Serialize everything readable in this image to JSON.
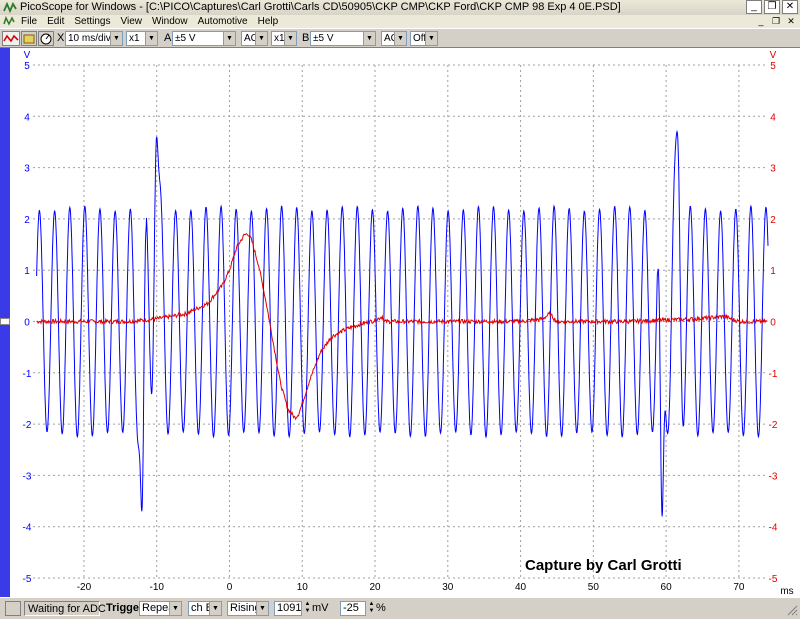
{
  "window": {
    "title": "PicoScope for Windows - [C:\\PICO\\Captures\\Carl Grotti\\Carls CD\\50905\\CKP CMP\\CKP Ford\\CKP CMP 98 Exp 4 0E.PSD]",
    "minimize": "_",
    "restore": "❐",
    "close": "✕"
  },
  "menu": {
    "items": [
      "File",
      "Edit",
      "Settings",
      "View",
      "Window",
      "Automotive",
      "Help"
    ],
    "mdi_minimize": "_",
    "mdi_restore": "❐",
    "mdi_close": "✕"
  },
  "toolbar": {
    "x_label": "X",
    "timebase": "10 ms/div",
    "multiplier": "x1",
    "mode_value": "A",
    "a_label": "A",
    "a_range": "±5 V",
    "a_coupling": "AC",
    "a_mult": "x1",
    "b_label": "B",
    "b_range": "±5 V",
    "b_coupling": "AC",
    "b_extra": "Off"
  },
  "statusbar": {
    "status": "Waiting for ADC",
    "trigger_label": "Trigger",
    "trigger_mode": "Repeat",
    "trigger_channel": "ch B",
    "trigger_edge": "Rising",
    "trigger_level": "1091",
    "level_unit": "mV",
    "pretrigger": "-25",
    "pretrigger_unit": "%"
  },
  "colors": {
    "channel_a": "#0000ff",
    "channel_b": "#e00000",
    "grid": "#a0a0a0"
  },
  "chart_data": {
    "type": "line",
    "watermark": "Capture by Carl Grotti",
    "left_axis_unit": "V",
    "right_axis_unit": "V",
    "x_unit": "ms",
    "xlim": [
      -27,
      74
    ],
    "ylim": [
      -5,
      5
    ],
    "x_ticks": [
      -20,
      -10,
      0,
      10,
      20,
      30,
      40,
      50,
      60,
      70
    ],
    "y_ticks": [
      5,
      4,
      3,
      2,
      1,
      0,
      -1,
      -2,
      -3,
      -4,
      -5
    ],
    "grid": true,
    "series": [
      {
        "channel": "A",
        "color": "#0000ff",
        "pattern": "square-ish crankshaft position sensor oscillation",
        "cycle_period_ms": 2.08,
        "amplitude_v": 2.2,
        "x_start": -26.5,
        "x_end": 74,
        "missing_tooth_events": [
          {
            "x": -11.5,
            "peak_v": 3.6,
            "trough_v": -3.7
          },
          {
            "x": 60.0,
            "peak_v": 3.7,
            "trough_v": -3.8
          }
        ]
      },
      {
        "channel": "B",
        "color": "#e00000",
        "pattern": "camshaft position sensor pulse",
        "points": [
          [
            -26.5,
            0.0
          ],
          [
            -20,
            0.0
          ],
          [
            -14,
            0.0
          ],
          [
            -10,
            0.05
          ],
          [
            -6,
            0.15
          ],
          [
            -3,
            0.35
          ],
          [
            -1,
            0.7
          ],
          [
            0,
            1.0
          ],
          [
            1,
            1.45
          ],
          [
            2,
            1.68
          ],
          [
            2.5,
            1.72
          ],
          [
            3,
            1.6
          ],
          [
            4,
            1.1
          ],
          [
            5,
            0.4
          ],
          [
            6,
            -0.4
          ],
          [
            7,
            -1.2
          ],
          [
            8,
            -1.7
          ],
          [
            9,
            -1.88
          ],
          [
            9.5,
            -1.8
          ],
          [
            10,
            -1.6
          ],
          [
            11,
            -1.15
          ],
          [
            12.5,
            -0.6
          ],
          [
            14,
            -0.3
          ],
          [
            16,
            -0.15
          ],
          [
            18,
            -0.05
          ],
          [
            20,
            0.02
          ],
          [
            21,
            0.1
          ],
          [
            21.3,
            0.0
          ],
          [
            30,
            0.0
          ],
          [
            40,
            0.0
          ],
          [
            43,
            0.05
          ],
          [
            44,
            0.15
          ],
          [
            45,
            0.0
          ],
          [
            55,
            0.0
          ],
          [
            64,
            0.05
          ],
          [
            68,
            0.1
          ],
          [
            69,
            0.05
          ],
          [
            70,
            0.0
          ],
          [
            74,
            0.0
          ]
        ]
      }
    ]
  }
}
